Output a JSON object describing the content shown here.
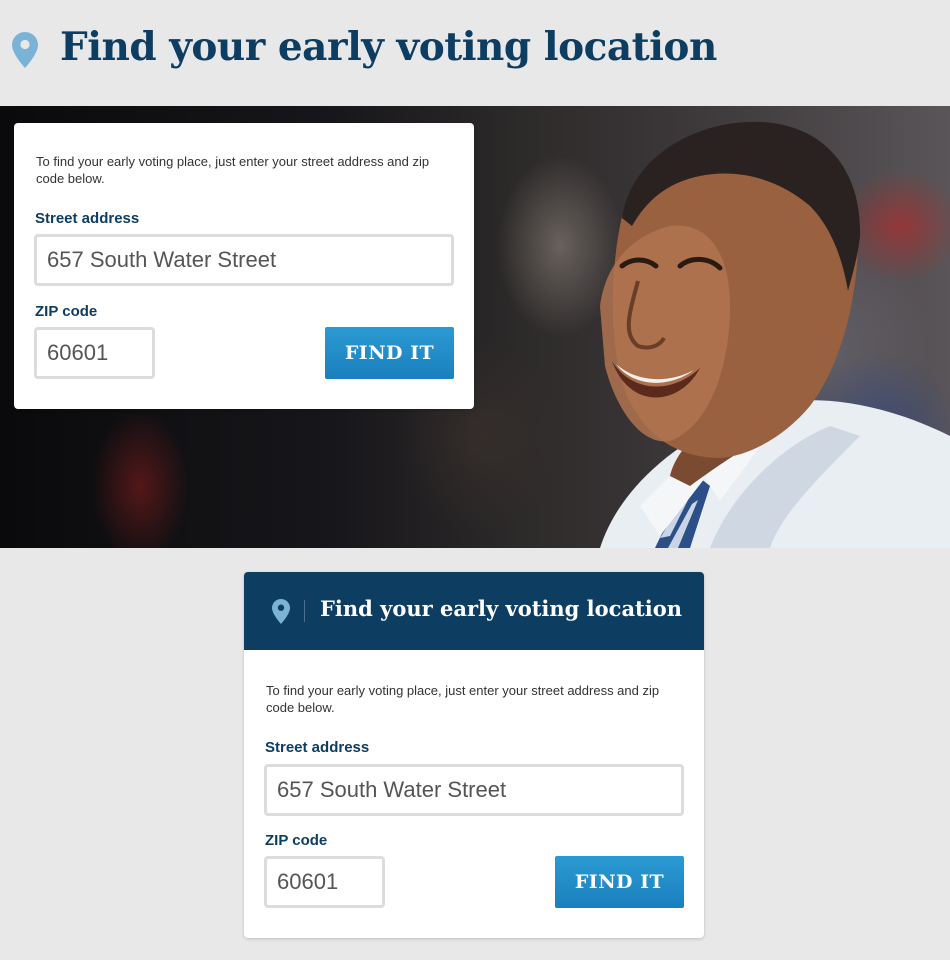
{
  "page": {
    "title": "Find your early voting location"
  },
  "colors": {
    "navy": "#0e3d62",
    "button_blue": "#1a80bd",
    "pin_blue": "#7ab3d6",
    "page_bg": "#e8e8e8"
  },
  "hero_form": {
    "intro": "To find your early voting place, just enter your street address and zip code below.",
    "street_label": "Street address",
    "street_value": "657 South Water Street",
    "zip_label": "ZIP code",
    "zip_value": "60601",
    "button_label": "FIND IT"
  },
  "widget": {
    "header_title": "Find your early voting location",
    "intro": "To find your early voting place, just enter your street address and zip code below.",
    "street_label": "Street address",
    "street_value": "657 South Water Street",
    "zip_label": "ZIP code",
    "zip_value": "60601",
    "button_label": "FIND IT"
  },
  "icons": {
    "header_icon": "map-pin-icon",
    "widget_icon": "map-pin-icon"
  }
}
